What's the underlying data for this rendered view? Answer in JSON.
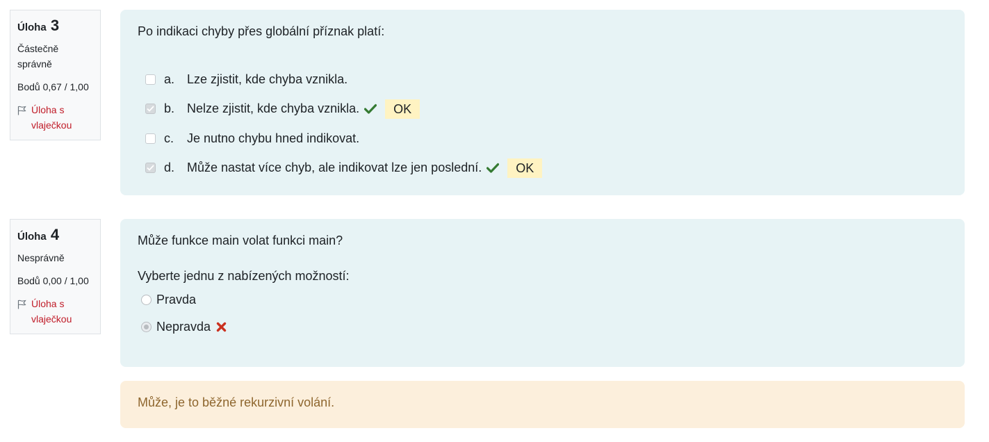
{
  "q3": {
    "heading": "Úloha",
    "number": "3",
    "state": "Částečně správně",
    "grade": "Bodů 0,67 / 1,00",
    "flag_label": "Úloha s vlaječkou",
    "question_text": "Po indikaci chyby přes globální příznak platí:",
    "answers": [
      {
        "letter": "a.",
        "text": "Lze zjistit, kde chyba vznikla.",
        "checked": false
      },
      {
        "letter": "b.",
        "text": "Nelze zjistit, kde chyba vznikla.",
        "checked": true,
        "feedback": "OK"
      },
      {
        "letter": "c.",
        "text": "Je nutno chybu hned indikovat.",
        "checked": false
      },
      {
        "letter": "d.",
        "text": "Může nastat více chyb, ale indikovat lze jen poslední.",
        "checked": true,
        "feedback": "OK"
      }
    ]
  },
  "q4": {
    "heading": "Úloha",
    "number": "4",
    "state": "Nesprávně",
    "grade": "Bodů 0,00 / 1,00",
    "flag_label": "Úloha s vlaječkou",
    "question_text": "Může funkce main volat funkci main?",
    "prompt": "Vyberte jednu z nabízených možností:",
    "options": [
      {
        "text": "Pravda",
        "selected": false
      },
      {
        "text": "Nepravda",
        "selected": true
      }
    ],
    "general_feedback": "Může, je to běžné rekurzivní volání."
  },
  "colors": {
    "correct_icon": "#357a32",
    "incorrect_icon": "#ca3120",
    "flag_link": "#c01c28",
    "question_bg": "#e7f3f5",
    "feedback_bg": "#fcefdc",
    "ok_badge_bg": "#fff3c2"
  },
  "icons": {
    "flag": "flag-outline-icon",
    "correct": "check-icon",
    "incorrect": "cross-icon"
  }
}
